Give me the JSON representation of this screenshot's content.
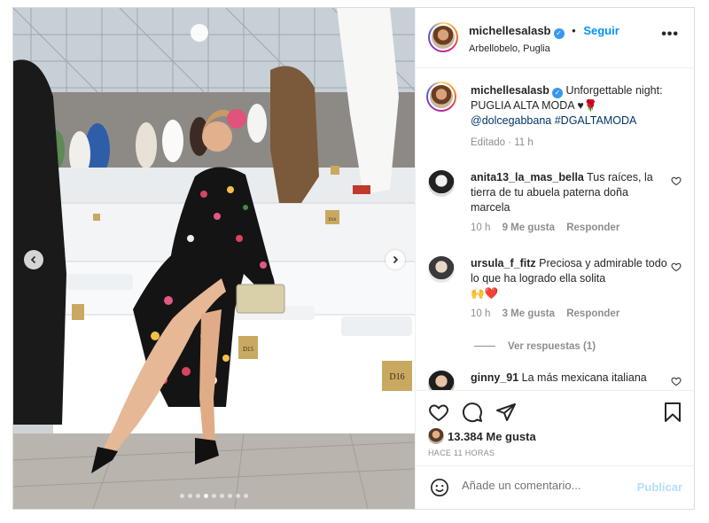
{
  "post": {
    "author": "michellesalasb",
    "follow_label": "Seguir",
    "separator": "•",
    "location": "Arbellobelo, Puglia",
    "more_label": "•••",
    "caption": {
      "text": "Unforgettable night: PUGLIA ALTA MODA ♥🌹",
      "mention": "@dolcegabbana",
      "hashtag": "#DGALTAMODA",
      "edited": "Editado · 11 h"
    },
    "media": {
      "seats": [
        "D16",
        "D15",
        "D16"
      ],
      "carousel_count": 9,
      "carousel_active": 3
    }
  },
  "comments": [
    {
      "user": "anita13_la_mas_bella",
      "text": "Tus raíces, la tierra de tu abuela paterna doña marcela",
      "time": "10 h",
      "likes": "9 Me gusta",
      "reply": "Responder"
    },
    {
      "user": "ursula_f_fitz",
      "text": "Preciosa y admirable todo lo que ha logrado ella solita",
      "emoji": "🙌❤️",
      "time": "10 h",
      "likes": "3 Me gusta",
      "reply": "Responder"
    },
    {
      "user": "ginny_91",
      "text": "La más mexicana italiana"
    }
  ],
  "view_replies": "Ver respuestas (1)",
  "likes_count": "13.384 Me gusta",
  "posted_ago": "HACE 11 HORAS",
  "comment_box": {
    "placeholder": "Añade un comentario...",
    "publish_label": "Publicar"
  },
  "colors": {
    "link": "#0095f6",
    "verified": "#3897f0",
    "publish_disabled": "#b2dffc",
    "mention": "#00376b"
  }
}
